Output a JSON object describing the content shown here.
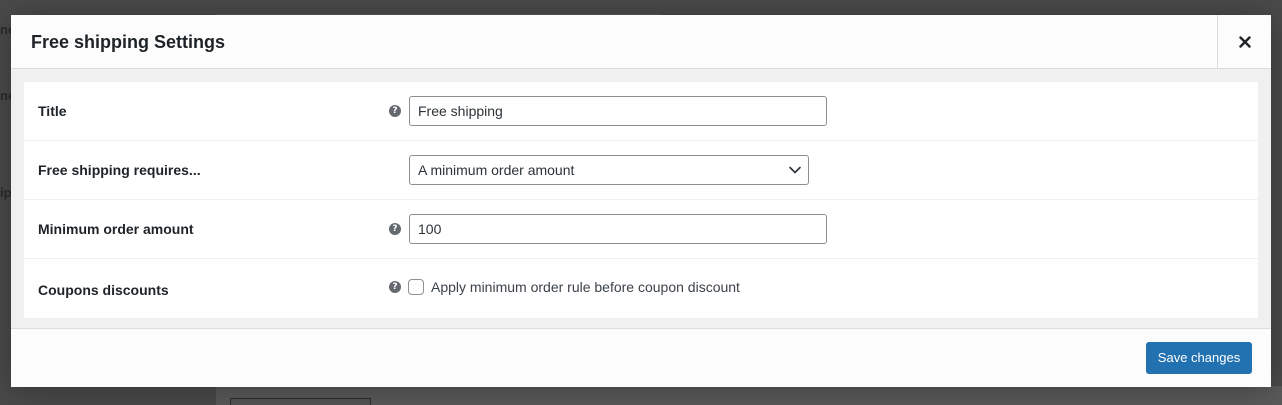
{
  "background": {
    "fragment_1": "ne",
    "fragment_2": "ne",
    "fragment_3": "ip"
  },
  "modal": {
    "title": "Free shipping Settings",
    "close_icon": "close-icon",
    "fields": {
      "title": {
        "label": "Title",
        "help_icon": "question-circle-icon",
        "value": "Free shipping"
      },
      "requires": {
        "label": "Free shipping requires...",
        "selected": "A minimum order amount",
        "chevron_icon": "chevron-down-icon"
      },
      "min_amount": {
        "label": "Minimum order amount",
        "help_icon": "question-circle-icon",
        "value": "100"
      },
      "coupons": {
        "label": "Coupons discounts",
        "help_icon": "question-circle-icon",
        "checkbox_label": "Apply minimum order rule before coupon discount",
        "checked": false
      }
    },
    "footer": {
      "save_label": "Save changes"
    }
  },
  "colors": {
    "primary_button": "#2271b1",
    "overlay": "#4a4a4a",
    "help_icon": "#646970"
  }
}
